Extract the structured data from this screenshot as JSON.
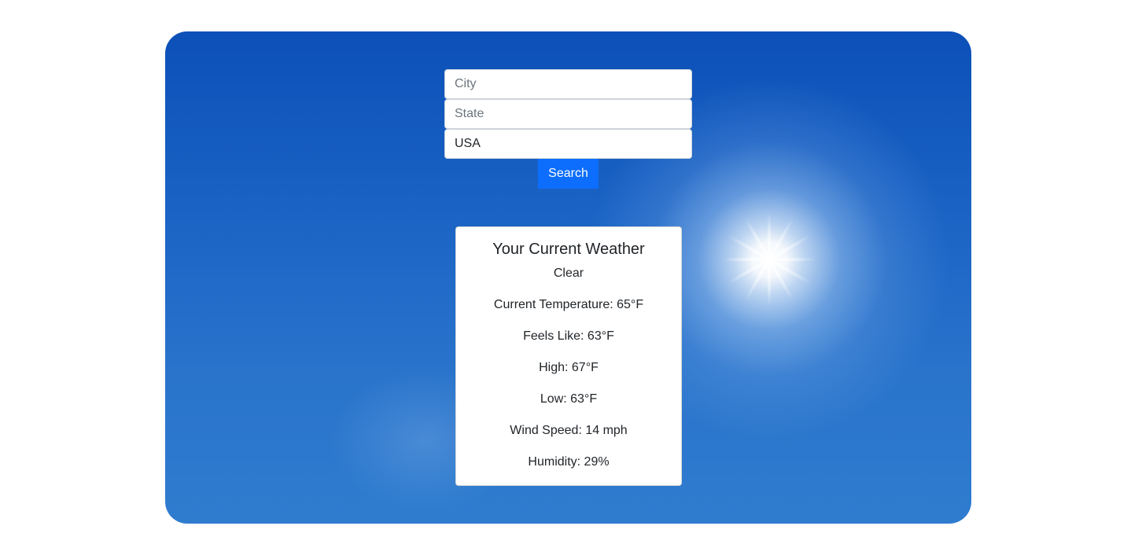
{
  "search": {
    "city_placeholder": "City",
    "city_value": "",
    "state_placeholder": "State",
    "state_value": "",
    "country_placeholder": "",
    "country_value": "USA",
    "button_label": "Search"
  },
  "weather": {
    "title": "Your Current Weather",
    "condition": "Clear",
    "current_temperature": "Current Temperature: 65°F",
    "feels_like": "Feels Like: 63°F",
    "high": "High: 67°F",
    "low": "Low: 63°F",
    "wind_speed": "Wind Speed: 14 mph",
    "humidity": "Humidity: 29%"
  },
  "colors": {
    "page_background": "#ffffff",
    "sky_top": "#0c50b8",
    "sky_bottom": "#2f7ccf",
    "button": "#0d6efd",
    "button_text": "#ffffff",
    "card_background": "#ffffff"
  },
  "background_image": "sunny-sky-with-bright-sun"
}
